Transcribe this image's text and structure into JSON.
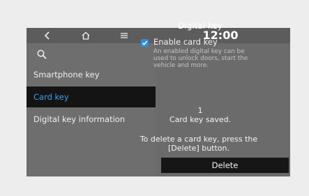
{
  "topbar": {
    "back_icon": "chevron-left-icon",
    "home_icon": "home-icon",
    "menu_icon": "menu-icon",
    "time": "12:00"
  },
  "search": {
    "icon": "search-icon"
  },
  "sidebar": {
    "items": [
      {
        "label": "Smartphone key",
        "selected": false
      },
      {
        "label": "Card key",
        "selected": true
      },
      {
        "label": "Digital key information",
        "selected": false
      }
    ]
  },
  "main": {
    "title": "Digital key",
    "enable_card_key": {
      "checked": true,
      "label": "Enable card key",
      "description": "An enabled digital key can be used to unlock doors, start the vehicle and more."
    },
    "card_count": "1",
    "saved_text": "Card key saved.",
    "delete_info": "To delete a card key, press the [Delete] button.",
    "delete_label": "Delete"
  },
  "colors": {
    "accent": "#3aa0e6",
    "checkbox": "#2f8de0"
  }
}
